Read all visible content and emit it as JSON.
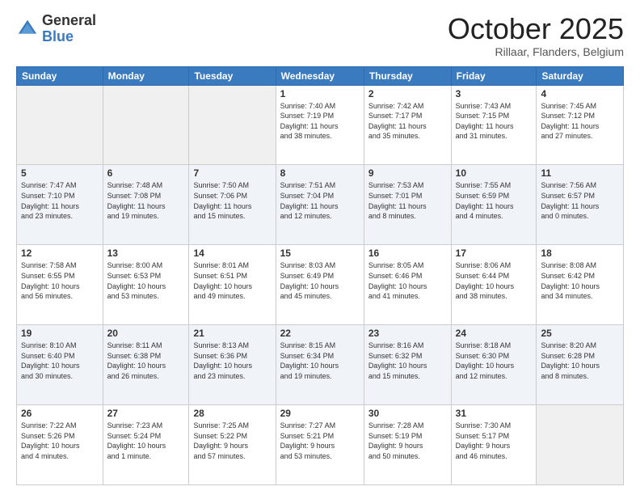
{
  "header": {
    "logo_general": "General",
    "logo_blue": "Blue",
    "month": "October 2025",
    "location": "Rillaar, Flanders, Belgium"
  },
  "days_of_week": [
    "Sunday",
    "Monday",
    "Tuesday",
    "Wednesday",
    "Thursday",
    "Friday",
    "Saturday"
  ],
  "weeks": [
    [
      {
        "day": "",
        "info": ""
      },
      {
        "day": "",
        "info": ""
      },
      {
        "day": "",
        "info": ""
      },
      {
        "day": "1",
        "info": "Sunrise: 7:40 AM\nSunset: 7:19 PM\nDaylight: 11 hours\nand 38 minutes."
      },
      {
        "day": "2",
        "info": "Sunrise: 7:42 AM\nSunset: 7:17 PM\nDaylight: 11 hours\nand 35 minutes."
      },
      {
        "day": "3",
        "info": "Sunrise: 7:43 AM\nSunset: 7:15 PM\nDaylight: 11 hours\nand 31 minutes."
      },
      {
        "day": "4",
        "info": "Sunrise: 7:45 AM\nSunset: 7:12 PM\nDaylight: 11 hours\nand 27 minutes."
      }
    ],
    [
      {
        "day": "5",
        "info": "Sunrise: 7:47 AM\nSunset: 7:10 PM\nDaylight: 11 hours\nand 23 minutes."
      },
      {
        "day": "6",
        "info": "Sunrise: 7:48 AM\nSunset: 7:08 PM\nDaylight: 11 hours\nand 19 minutes."
      },
      {
        "day": "7",
        "info": "Sunrise: 7:50 AM\nSunset: 7:06 PM\nDaylight: 11 hours\nand 15 minutes."
      },
      {
        "day": "8",
        "info": "Sunrise: 7:51 AM\nSunset: 7:04 PM\nDaylight: 11 hours\nand 12 minutes."
      },
      {
        "day": "9",
        "info": "Sunrise: 7:53 AM\nSunset: 7:01 PM\nDaylight: 11 hours\nand 8 minutes."
      },
      {
        "day": "10",
        "info": "Sunrise: 7:55 AM\nSunset: 6:59 PM\nDaylight: 11 hours\nand 4 minutes."
      },
      {
        "day": "11",
        "info": "Sunrise: 7:56 AM\nSunset: 6:57 PM\nDaylight: 11 hours\nand 0 minutes."
      }
    ],
    [
      {
        "day": "12",
        "info": "Sunrise: 7:58 AM\nSunset: 6:55 PM\nDaylight: 10 hours\nand 56 minutes."
      },
      {
        "day": "13",
        "info": "Sunrise: 8:00 AM\nSunset: 6:53 PM\nDaylight: 10 hours\nand 53 minutes."
      },
      {
        "day": "14",
        "info": "Sunrise: 8:01 AM\nSunset: 6:51 PM\nDaylight: 10 hours\nand 49 minutes."
      },
      {
        "day": "15",
        "info": "Sunrise: 8:03 AM\nSunset: 6:49 PM\nDaylight: 10 hours\nand 45 minutes."
      },
      {
        "day": "16",
        "info": "Sunrise: 8:05 AM\nSunset: 6:46 PM\nDaylight: 10 hours\nand 41 minutes."
      },
      {
        "day": "17",
        "info": "Sunrise: 8:06 AM\nSunset: 6:44 PM\nDaylight: 10 hours\nand 38 minutes."
      },
      {
        "day": "18",
        "info": "Sunrise: 8:08 AM\nSunset: 6:42 PM\nDaylight: 10 hours\nand 34 minutes."
      }
    ],
    [
      {
        "day": "19",
        "info": "Sunrise: 8:10 AM\nSunset: 6:40 PM\nDaylight: 10 hours\nand 30 minutes."
      },
      {
        "day": "20",
        "info": "Sunrise: 8:11 AM\nSunset: 6:38 PM\nDaylight: 10 hours\nand 26 minutes."
      },
      {
        "day": "21",
        "info": "Sunrise: 8:13 AM\nSunset: 6:36 PM\nDaylight: 10 hours\nand 23 minutes."
      },
      {
        "day": "22",
        "info": "Sunrise: 8:15 AM\nSunset: 6:34 PM\nDaylight: 10 hours\nand 19 minutes."
      },
      {
        "day": "23",
        "info": "Sunrise: 8:16 AM\nSunset: 6:32 PM\nDaylight: 10 hours\nand 15 minutes."
      },
      {
        "day": "24",
        "info": "Sunrise: 8:18 AM\nSunset: 6:30 PM\nDaylight: 10 hours\nand 12 minutes."
      },
      {
        "day": "25",
        "info": "Sunrise: 8:20 AM\nSunset: 6:28 PM\nDaylight: 10 hours\nand 8 minutes."
      }
    ],
    [
      {
        "day": "26",
        "info": "Sunrise: 7:22 AM\nSunset: 5:26 PM\nDaylight: 10 hours\nand 4 minutes."
      },
      {
        "day": "27",
        "info": "Sunrise: 7:23 AM\nSunset: 5:24 PM\nDaylight: 10 hours\nand 1 minute."
      },
      {
        "day": "28",
        "info": "Sunrise: 7:25 AM\nSunset: 5:22 PM\nDaylight: 9 hours\nand 57 minutes."
      },
      {
        "day": "29",
        "info": "Sunrise: 7:27 AM\nSunset: 5:21 PM\nDaylight: 9 hours\nand 53 minutes."
      },
      {
        "day": "30",
        "info": "Sunrise: 7:28 AM\nSunset: 5:19 PM\nDaylight: 9 hours\nand 50 minutes."
      },
      {
        "day": "31",
        "info": "Sunrise: 7:30 AM\nSunset: 5:17 PM\nDaylight: 9 hours\nand 46 minutes."
      },
      {
        "day": "",
        "info": ""
      }
    ]
  ]
}
